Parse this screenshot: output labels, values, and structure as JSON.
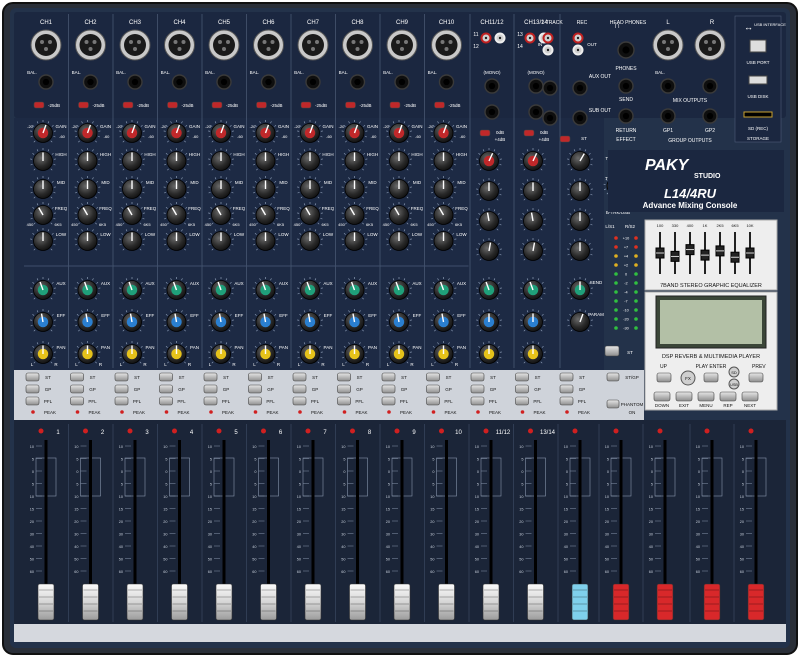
{
  "brand": {
    "name": "PAKY",
    "sub": "STUDIO",
    "model": "L14/4RU",
    "tagline": "Advance Mixing Console"
  },
  "channels": {
    "top_labels": [
      "CH1",
      "CH2",
      "CH3",
      "CH4",
      "CH5",
      "CH6",
      "CH7",
      "CH8",
      "CH9",
      "CH10"
    ],
    "bal_label": "BAL.",
    "pad_label": "-25dB",
    "knob_labels": [
      "GAIN",
      "HIGH",
      "MID",
      "FREQ",
      "LOW",
      "AUX",
      "EFF",
      "PAN"
    ],
    "gain_marks": [
      "-20",
      "-60"
    ],
    "freq_marks": [
      "450",
      "6K5"
    ],
    "pan_marks": [
      "L",
      "R"
    ]
  },
  "stereo_channels": {
    "labels": [
      "CH11/12",
      "CH13/14"
    ],
    "in_labels": [
      "11",
      "12",
      "13",
      "14"
    ],
    "mono_label": "(MONO)",
    "pad_labels": [
      "0dB",
      "+4dB"
    ]
  },
  "io": {
    "two_track": "2-TRACK",
    "rec": "REC",
    "in": "IN",
    "out": "OUT",
    "head_phones": "HEAD PHONES",
    "phones": "PHONES",
    "aux_out": "AUX OUT",
    "send": "SEND",
    "sub_out": "SUB OUT",
    "return": "RETURN",
    "effect": "EFFECT",
    "mix_outputs": "MIX OUTPUTS",
    "group_outputs": "GROUP OUTPUTS",
    "gp1": "GP1",
    "gp2": "GP2",
    "l": "L",
    "r": "R",
    "usb_interface": "USB INTERFACE",
    "usb_port": "USB PORT",
    "usb_disk": "USB DISK",
    "sd_rec": "SD (REC)",
    "storage": "STORAGE"
  },
  "master": {
    "to_st": "TO ST",
    "to_gp": "TO GP",
    "return_label": "RETURN",
    "bypass": "B-TRK/USB",
    "send": "SEND",
    "param": "PARAM",
    "meter_labels": [
      "L/S1",
      "R/S2"
    ],
    "meter_marks": [
      "+10",
      "+7",
      "+4",
      "+2",
      "0",
      "-2",
      "-4",
      "-7",
      "-10",
      "-20",
      "-30"
    ],
    "st_button": "ST",
    "st_gp_button": "ST/GP",
    "phantom_button": "PHANTOM",
    "on_label": "ON"
  },
  "eq": {
    "title": "7BAND STEREO GRAPHIC EQUALIZER",
    "bands": [
      "100",
      "330",
      "400",
      "1K",
      "2K5",
      "6K5",
      "10K"
    ],
    "levels": [
      0.5,
      0.58,
      0.42,
      0.55,
      0.45,
      0.6,
      0.5
    ]
  },
  "dsp": {
    "title": "DSP REVERB & MULTIMEDIA PLAYER",
    "up": "UP",
    "play_enter": "PLAY ENTER",
    "prev": "PREV",
    "buttons": [
      "FX",
      "SD",
      "USB"
    ],
    "bottom": [
      "DOWN",
      "EXIT",
      "MENU",
      "REP",
      "NEXT"
    ]
  },
  "strip_buttons": {
    "st": "ST",
    "gp": "GP",
    "pfl": "PFL",
    "peak": "PEAK"
  },
  "faders": {
    "numbers": [
      "1",
      "2",
      "3",
      "4",
      "5",
      "6",
      "7",
      "8",
      "9",
      "10",
      "11/12",
      "13/14"
    ],
    "scale": [
      "10",
      "5",
      "0",
      "5",
      "10",
      "15",
      "20",
      "30",
      "40",
      "50",
      "60"
    ],
    "bottom_labels": [
      "1",
      "2",
      "3",
      "4",
      "5",
      "6",
      "7",
      "8",
      "9",
      "10",
      "11/12",
      "13/14",
      "EFF",
      "1",
      "GP",
      "2",
      "L",
      "ST",
      "R"
    ]
  },
  "colors": {
    "panel": "#23324a",
    "panel_dark": "#17233a",
    "knob_red": "#c0282a",
    "knob_green": "#1fa07a",
    "knob_blue": "#2a7fd0",
    "knob_yellow": "#e6c21a",
    "fader_cap": "#e8e8e8",
    "fader_blue": "#7fd0ec",
    "fader_red": "#d8282a"
  }
}
